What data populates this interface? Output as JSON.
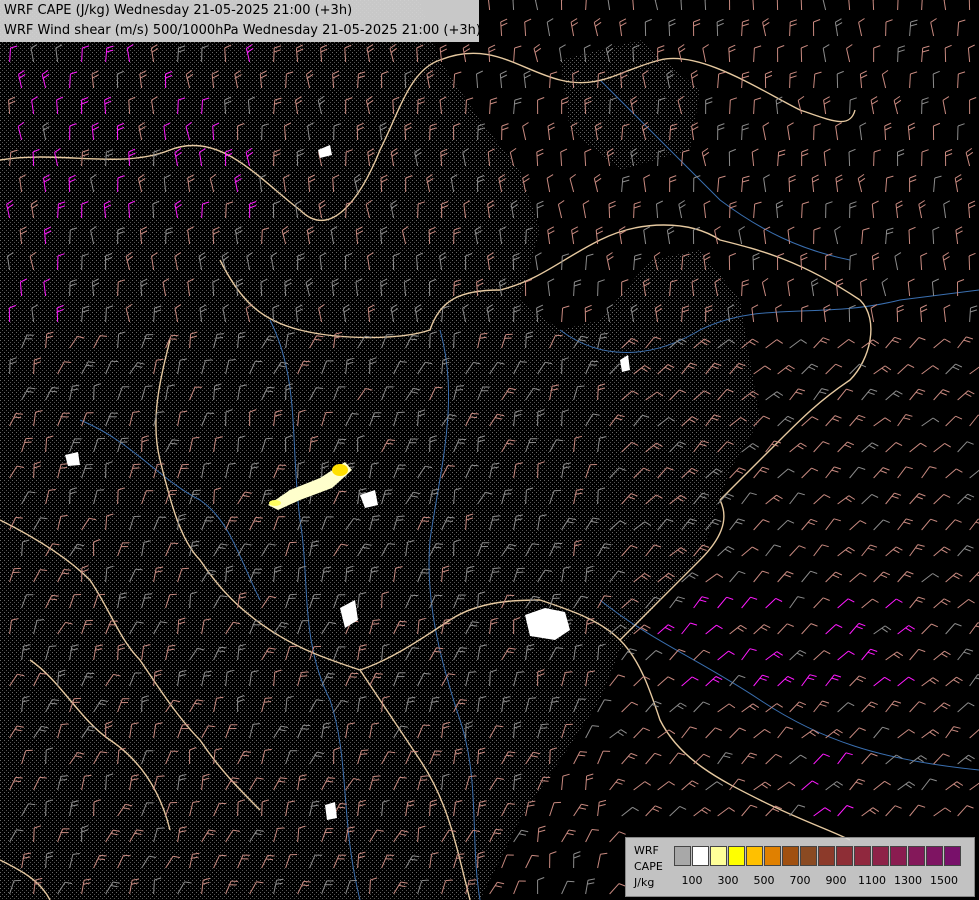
{
  "titles": {
    "line1": "WRF CAPE (J/kg) Wednesday 21-05-2025 21:00 (+3h)",
    "line2": "WRF Wind shear (m/s) 500/1000hPa Wednesday 21-05-2025 21:00 (+3h)"
  },
  "legend": {
    "label1": "WRF",
    "label2": "CAPE",
    "label3": "J/kg",
    "swatch_colors": [
      "#a8a8a8",
      "#ffffff",
      "#ffff99",
      "#ffff00",
      "#ffc000",
      "#e08000",
      "#a05010",
      "#8a4a22",
      "#8c3a2a",
      "#8e2e36",
      "#90283e",
      "#8e2248",
      "#8a1c50",
      "#84185a",
      "#7e1462",
      "#78106a"
    ],
    "ticks": [
      "100",
      "300",
      "500",
      "700",
      "900",
      "1100",
      "1300",
      "1500"
    ]
  },
  "colors": {
    "background": "#000000",
    "border": "#e6c9a0",
    "river": "#3a6fb0",
    "barb_grey": "#8c8c8c",
    "barb_pink": "#c98a80",
    "barb_magenta": "#ff1aff"
  }
}
